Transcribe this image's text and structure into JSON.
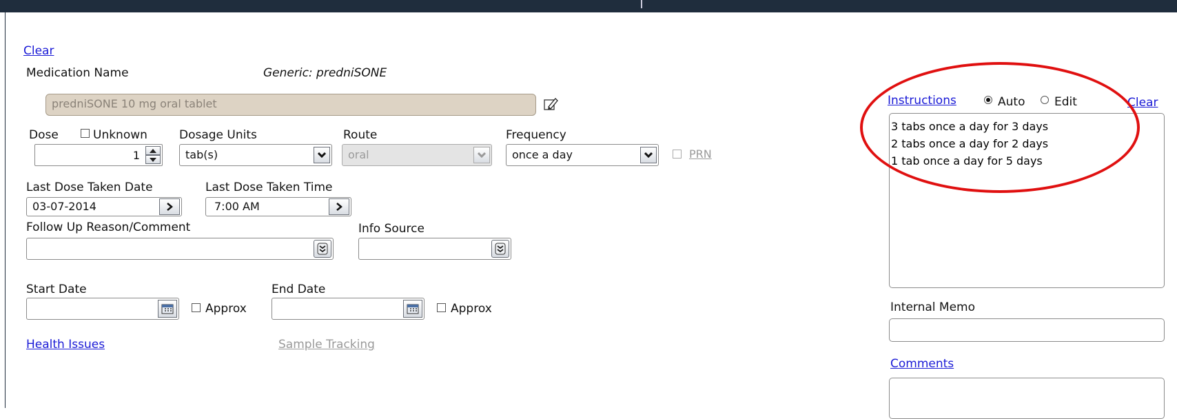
{
  "form": {
    "clear_link": "Clear",
    "medication_name_label": "Medication Name",
    "generic_label": "Generic: predniSONE",
    "medication_value": "predniSONE 10 mg oral tablet",
    "dose_label": "Dose",
    "unknown_label": "Unknown",
    "dose_value": "1",
    "dosage_units_label": "Dosage Units",
    "dosage_units_value": "tab(s)",
    "route_label": "Route",
    "route_value": "oral",
    "frequency_label": "Frequency",
    "frequency_value": "once a day",
    "prn_label": "PRN",
    "last_dose_date_label": "Last Dose Taken Date",
    "last_dose_date_value": "03-07-2014",
    "last_dose_time_label": "Last Dose Taken Time",
    "last_dose_time_value": "7:00 AM",
    "follow_up_label": "Follow Up Reason/Comment",
    "follow_up_value": "",
    "info_source_label": "Info Source",
    "info_source_value": "",
    "start_date_label": "Start Date",
    "start_date_value": "",
    "end_date_label": "End Date",
    "end_date_value": "",
    "approx_label": "Approx",
    "health_issues_link": "Health Issues",
    "sample_tracking_link": "Sample Tracking"
  },
  "instructions": {
    "link": "Instructions",
    "auto_label": "Auto",
    "edit_label": "Edit",
    "clear_link": "Clear",
    "selected_mode": "Auto",
    "lines": [
      "3 tabs once a day for 3 days",
      "2 tabs once a day for 2 days",
      "1 tab once a day for 5 days"
    ]
  },
  "internal_memo": {
    "label": "Internal Memo",
    "value": ""
  },
  "comments": {
    "link": "Comments",
    "value": ""
  },
  "colors": {
    "annotation": "#e01010",
    "link": "#1a1ad6",
    "readonly_field": "#ddd3c4"
  }
}
